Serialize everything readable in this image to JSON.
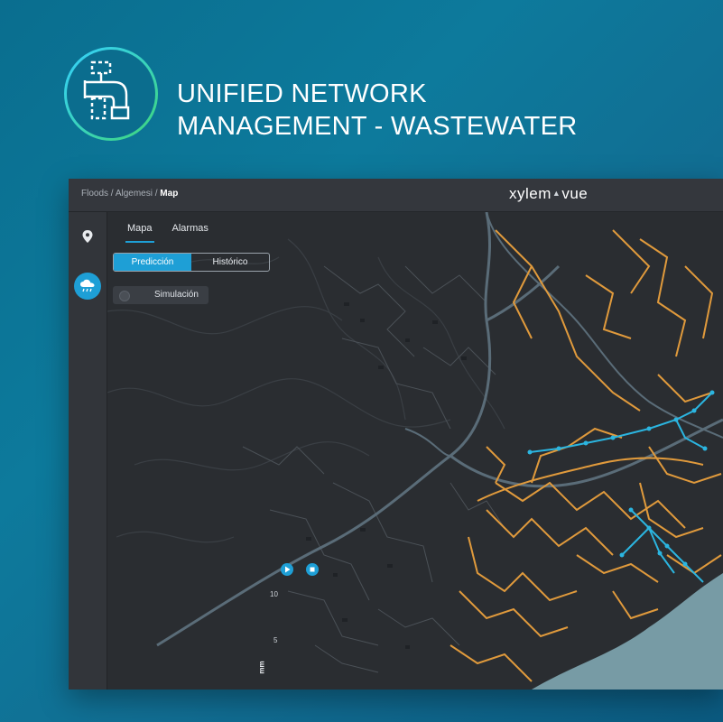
{
  "hero": {
    "title_line1": "UNIFIED NETWORK",
    "title_line2": "MANAGEMENT - WASTEWATER",
    "icon": "pipe-network-icon"
  },
  "app": {
    "breadcrumb": {
      "part1": "Floods",
      "sep1": " / ",
      "part2": "Algemesi",
      "sep2": " / ",
      "current": "Map"
    },
    "logo": {
      "left": "xylem",
      "right": "vue"
    },
    "sidebar": {
      "items": [
        {
          "icon": "location-pin-icon"
        },
        {
          "icon": "rain-cloud-icon",
          "active": true
        }
      ]
    },
    "tabs": [
      {
        "label": "Mapa",
        "active": true
      },
      {
        "label": "Alarmas"
      }
    ],
    "segment": [
      {
        "label": "Predicción",
        "active": true
      },
      {
        "label": "Histórico"
      }
    ],
    "toggle": {
      "label": "Simulación",
      "on": false
    },
    "scale": {
      "values": [
        "10",
        "5"
      ],
      "unit": "mm"
    }
  },
  "colors": {
    "accent": "#1e9fd6",
    "network_orange": "#e09a3c",
    "network_blue": "#2bb5e0",
    "map_bg": "#2a2d31",
    "road": "#5a6c78"
  }
}
